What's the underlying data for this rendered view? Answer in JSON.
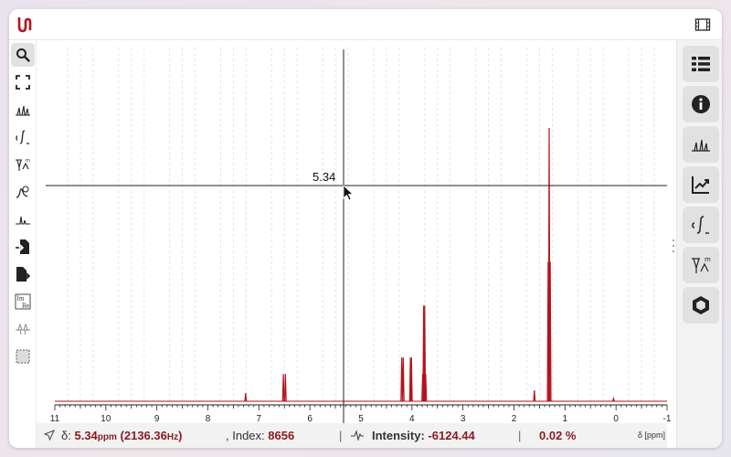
{
  "app": {
    "logo_icon": "nmrium-logo",
    "film_icon": "film-icon",
    "accent": "#b5121b"
  },
  "left_tools": [
    {
      "name": "zoom",
      "icon": "magnifier-icon",
      "active": true
    },
    {
      "name": "full-screen",
      "icon": "fullscreen-icon"
    },
    {
      "name": "peak-picking",
      "icon": "peaks-icon"
    },
    {
      "name": "integration",
      "icon": "integral-icon"
    },
    {
      "name": "multiplet-analysis",
      "icon": "multiplet-icon"
    },
    {
      "name": "phase-correction",
      "icon": "phase-icon"
    },
    {
      "name": "baseline-correction",
      "icon": "baseline-icon"
    },
    {
      "name": "import",
      "icon": "file-import-icon"
    },
    {
      "name": "export",
      "icon": "file-export-icon"
    },
    {
      "name": "real-imaginary",
      "icon": "re-im-icon"
    },
    {
      "name": "alignment",
      "icon": "align-icon"
    },
    {
      "name": "select-region",
      "icon": "dashed-square-icon"
    }
  ],
  "right_panels": [
    {
      "name": "spectra",
      "icon": "table-list-icon"
    },
    {
      "name": "information",
      "icon": "info-icon"
    },
    {
      "name": "peaks",
      "icon": "peaks-icon"
    },
    {
      "name": "chart",
      "icon": "chart-line-icon"
    },
    {
      "name": "integrals",
      "icon": "integral-icon"
    },
    {
      "name": "multiplets",
      "icon": "multiplet-icon"
    },
    {
      "name": "structures",
      "icon": "hexagon-icon"
    }
  ],
  "cursor": {
    "label": "5.34"
  },
  "status": {
    "delta_prefix": "δ:",
    "ppm_value": "5.34",
    "ppm_unit": "ppm",
    "hz_open": "(2136.36",
    "hz_unit": "Hz",
    "hz_close": ")",
    "index_label": ", Index:",
    "index_value": "8656",
    "sep": "|",
    "intensity_label": "Intensity:",
    "intensity_value": "-6124.44",
    "sep2": "|",
    "percent_value": "0.02 %",
    "axis_unit": "δ [ppm]"
  },
  "chart_data": {
    "type": "line",
    "xlabel": "δ [ppm]",
    "xlim": [
      11,
      -1
    ],
    "x_reversed": true,
    "ticks": [
      11,
      10,
      9,
      8,
      7,
      6,
      5,
      4,
      3,
      2,
      1,
      0,
      -1
    ],
    "tick_labels": [
      "11",
      "10",
      "9",
      "8",
      "7",
      "6",
      "5",
      "4",
      "3",
      "2",
      "1",
      "0",
      "-1"
    ],
    "series_color": "#b5121b",
    "peaks": [
      {
        "ppm": 7.26,
        "height": 0.03
      },
      {
        "ppm": 6.52,
        "height": 0.1
      },
      {
        "ppm": 6.48,
        "height": 0.1
      },
      {
        "ppm": 4.2,
        "height": 0.16
      },
      {
        "ppm": 4.17,
        "height": 0.16
      },
      {
        "ppm": 4.03,
        "height": 0.16
      },
      {
        "ppm": 4.01,
        "height": 0.16
      },
      {
        "ppm": 3.79,
        "height": 0.1
      },
      {
        "ppm": 3.77,
        "height": 0.35
      },
      {
        "ppm": 3.75,
        "height": 0.35
      },
      {
        "ppm": 3.73,
        "height": 0.1
      },
      {
        "ppm": 1.6,
        "height": 0.04
      },
      {
        "ppm": 1.33,
        "height": 0.51
      },
      {
        "ppm": 1.31,
        "height": 1.0
      },
      {
        "ppm": 1.29,
        "height": 0.51
      },
      {
        "ppm": 0.05,
        "height": 0.01
      }
    ],
    "cursor_ppm": 5.34
  }
}
